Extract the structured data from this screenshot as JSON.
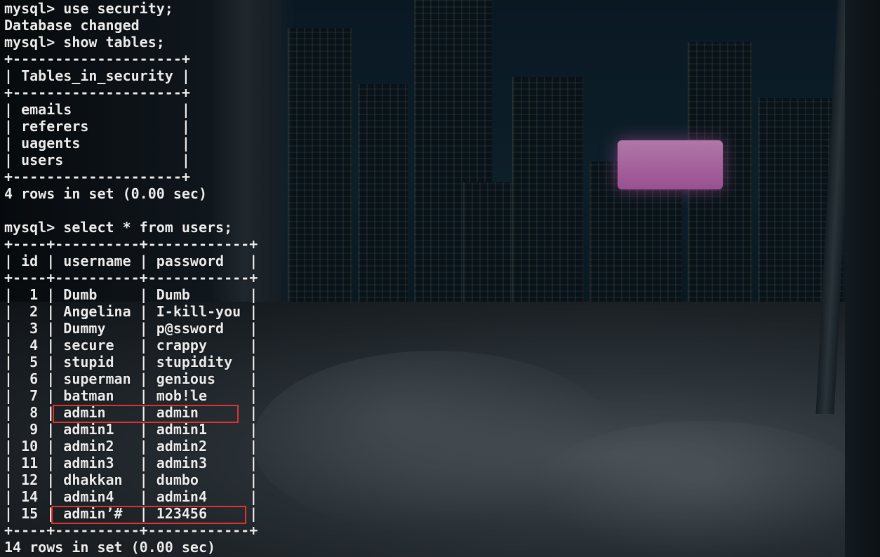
{
  "terminal": {
    "lines": [
      "mysql> use security;",
      "Database changed",
      "mysql> show tables;",
      "+--------------------+",
      "| Tables_in_security |",
      "+--------------------+",
      "| emails             |",
      "| referers           |",
      "| uagents            |",
      "| users              |",
      "+--------------------+",
      "4 rows in set (0.00 sec)",
      "",
      "mysql> select * from users;",
      "+----+----------+------------+",
      "| id | username | password   |",
      "+----+----------+------------+",
      "|  1 | Dumb     | Dumb       |",
      "|  2 | Angelina | I-kill-you |",
      "|  3 | Dummy    | p@ssword   |",
      "|  4 | secure   | crappy     |",
      "|  5 | stupid   | stupidity  |",
      "|  6 | superman | genious    |",
      "|  7 | batman   | mob!le     |",
      "|  8 | admin    | admin      |",
      "|  9 | admin1   | admin1     |",
      "| 10 | admin2   | admin2     |",
      "| 11 | admin3   | admin3     |",
      "| 12 | dhakkan  | dumbo      |",
      "| 14 | admin4   | admin4     |",
      "| 15 | admin’#  | 123456     |",
      "+----+----------+------------+",
      "14 rows in set (0.00 sec)"
    ]
  },
  "colors": {
    "text": "#ececec",
    "highlight": "#e0322e"
  },
  "annotations": [
    {
      "name": "highlight-admin-row",
      "row_id": "8"
    },
    {
      "name": "highlight-admin-hash-row",
      "row_id": "15"
    }
  ]
}
